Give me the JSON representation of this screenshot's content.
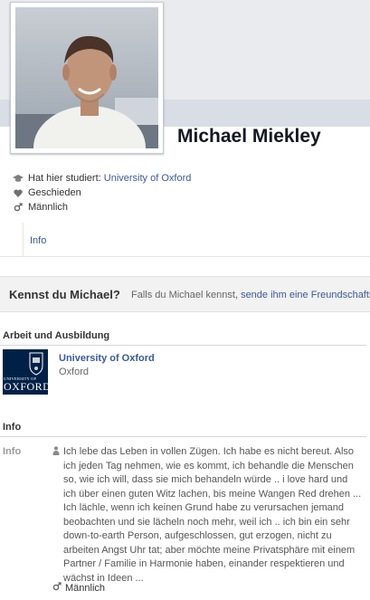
{
  "profile": {
    "name": "Michael Miekley"
  },
  "facts": {
    "studied_prefix": "Hat hier studiert:",
    "studied_link": "University of Oxford",
    "relationship": "Geschieden",
    "gender": "Männlich"
  },
  "tabs": {
    "info": "Info"
  },
  "know_bar": {
    "question": "Kennst du Michael?",
    "text_prefix": "Falls du Michael kennst,",
    "link": "sende ihm eine Freundschaftsa"
  },
  "work": {
    "heading": "Arbeit und Ausbildung",
    "logo_text": "UNIVERSITY OF",
    "logo_big": "OXFORD",
    "title": "University of Oxford",
    "subtitle": "Oxford"
  },
  "info": {
    "heading": "Info",
    "label": "Info",
    "bio": "Ich lebe das Leben in vollen Zügen. Ich habe es nicht bereut. Also ich jeden Tag nehmen, wie es kommt, ich behandle die Menschen so, wie ich will, dass sie mich behandeln würde .. i love hard und ich über einen guten Witz lachen, bis meine Wangen Red drehen ... Ich lächle, wenn ich keinen Grund habe zu verursachen jemand beobachten und sie lächeln noch mehr, weil ich .. ich bin ein sehr down-to-earth Person, aufgeschlossen, gut erzogen, nicht zu arbeiten Angst Uhr tat; aber möchte meine Privatsphäre mit einem Partner / Familie in Harmonie haben, einander respektieren und wächst in Ideen ...",
    "gender": "Männlich"
  },
  "colors": {
    "link": "#3b5998",
    "oxford_blue": "#002147"
  }
}
